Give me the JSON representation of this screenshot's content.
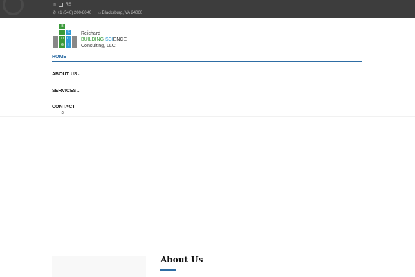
{
  "topbar": {
    "social": [
      "in",
      "ig",
      "RS"
    ],
    "phone": "+1 (540) 200-8040",
    "address": "Blacksburg, VA 24060"
  },
  "logo": {
    "green_letters": [
      "B",
      "L",
      "D",
      "G"
    ],
    "blue_letters": [
      "S",
      "C",
      "I"
    ],
    "line1": "Reichard",
    "line2a": "BUILDING",
    "line2b": " SCI",
    "line2c": "ENCE",
    "line3": "Consulting, LLC"
  },
  "nav": {
    "items": [
      "HOME",
      "ABOUT US",
      "SERVICES",
      "CONTACT"
    ],
    "chevron": "⌄",
    "search_icon": "⌕"
  },
  "content": {
    "heading": "About Us"
  },
  "colors": {
    "topbar": "#3d3d3d",
    "accent": "#2e6da4",
    "green": "#3a9a3a",
    "blue": "#2e9bd6"
  }
}
